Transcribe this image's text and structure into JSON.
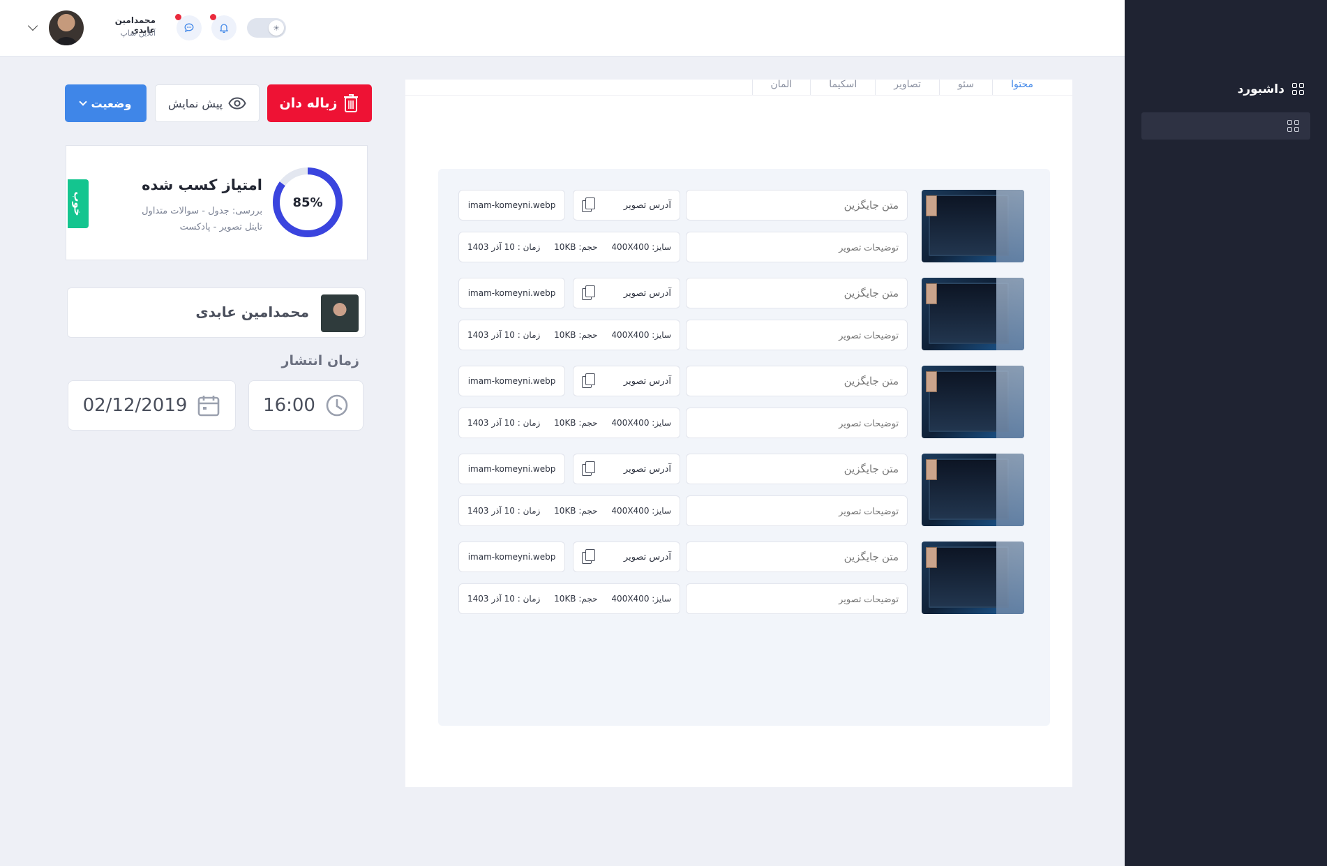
{
  "sidebar": {
    "dashboard_label": "داشبورد",
    "icons": [
      "grid-icon",
      "grid-icon"
    ]
  },
  "topbar": {
    "user_name": "محمدامین عابدی",
    "user_role": "آنلاین شاپ",
    "icons": [
      "chevron-down-icon",
      "chat-icon",
      "bell-icon",
      "sun-icon"
    ],
    "notification_dot_color": "#ea2a3c"
  },
  "actions": {
    "status_label": "وضعیت",
    "preview_label": "پیش نمایش",
    "trash_label": "زباله دان"
  },
  "score": {
    "title": "امتیاز کسب شده",
    "line1": "بررسی: جدول - سوالات متداول",
    "line2": "تایتل تصویر - پادکست",
    "value_text": "85%",
    "value": 0.85,
    "badge": "خوب",
    "ring_color": "#3a44de",
    "badge_color": "#14c58f"
  },
  "author": {
    "name": "محمدامین عابدی"
  },
  "publish": {
    "label": "زمان انتشار",
    "date": "02/12/2019",
    "time": "16:00"
  },
  "tabs": [
    {
      "label": "محتوا",
      "active": true
    },
    {
      "label": "سئو",
      "active": false
    },
    {
      "label": "تصاویر",
      "active": false
    },
    {
      "label": "اسکیما",
      "active": false
    },
    {
      "label": "المان",
      "active": false
    }
  ],
  "images": [
    {
      "alt_placeholder": "متن جایگزین",
      "desc_placeholder": "توضیحات تصویر",
      "address_label": "آدرس تصویر",
      "filename": "imam-komeyni.webp",
      "size_label": "سایز:",
      "size": "400X400",
      "volume_label": "حجم:",
      "volume": "10KB",
      "time_label": "زمان :",
      "time": "10 آذر 1403"
    },
    {
      "alt_placeholder": "متن جایگزین",
      "desc_placeholder": "توضیحات تصویر",
      "address_label": "آدرس تصویر",
      "filename": "imam-komeyni.webp",
      "size_label": "سایز:",
      "size": "400X400",
      "volume_label": "حجم:",
      "volume": "10KB",
      "time_label": "زمان :",
      "time": "10 آذر 1403"
    },
    {
      "alt_placeholder": "متن جایگزین",
      "desc_placeholder": "توضیحات تصویر",
      "address_label": "آدرس تصویر",
      "filename": "imam-komeyni.webp",
      "size_label": "سایز:",
      "size": "400X400",
      "volume_label": "حجم:",
      "volume": "10KB",
      "time_label": "زمان :",
      "time": "10 آذر 1403"
    },
    {
      "alt_placeholder": "متن جایگزین",
      "desc_placeholder": "توضیحات تصویر",
      "address_label": "آدرس تصویر",
      "filename": "imam-komeyni.webp",
      "size_label": "سایز:",
      "size": "400X400",
      "volume_label": "حجم:",
      "volume": "10KB",
      "time_label": "زمان :",
      "time": "10 آذر 1403"
    },
    {
      "alt_placeholder": "متن جایگزین",
      "desc_placeholder": "توضیحات تصویر",
      "address_label": "آدرس تصویر",
      "filename": "imam-komeyni.webp",
      "size_label": "سایز:",
      "size": "400X400",
      "volume_label": "حجم:",
      "volume": "10KB",
      "time_label": "زمان :",
      "time": "10 آذر 1403"
    }
  ]
}
